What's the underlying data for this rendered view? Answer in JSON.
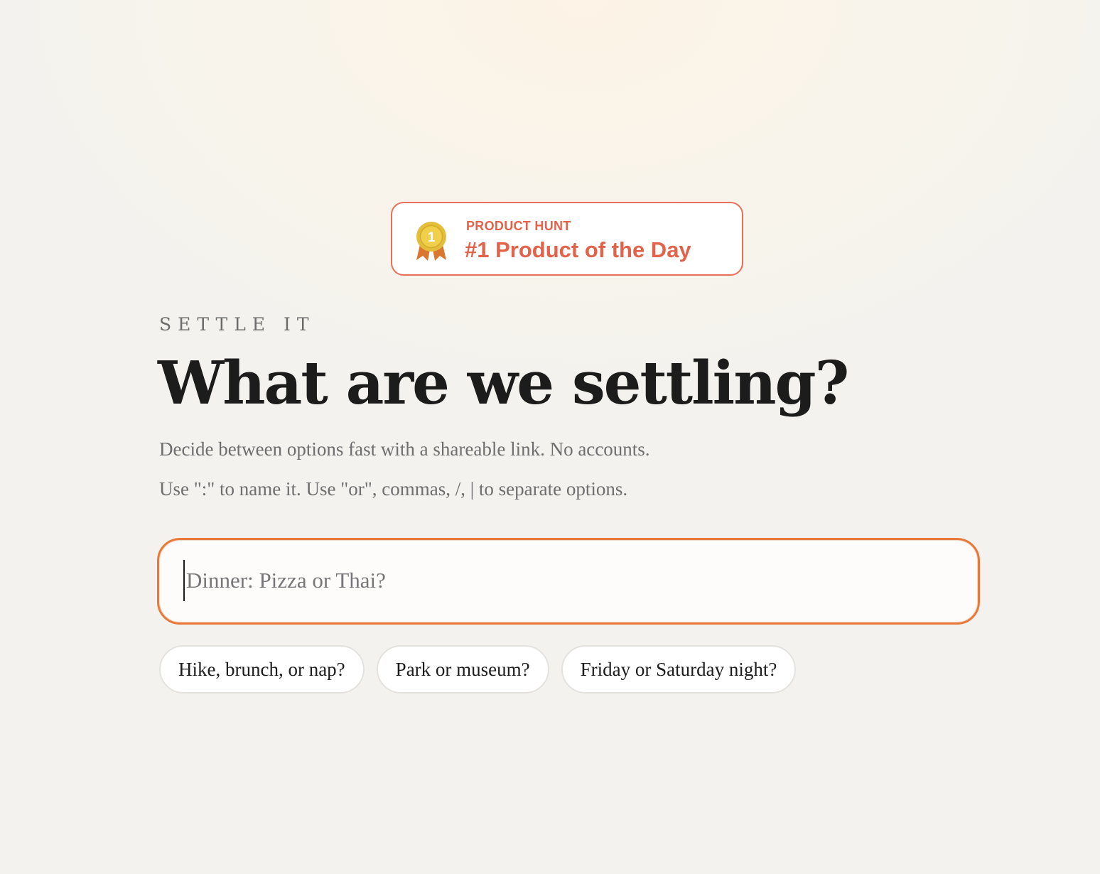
{
  "badge": {
    "medal_number": "1",
    "kicker": "PRODUCT HUNT",
    "headline": "#1 Product of the Day",
    "medal_icon": "medal-icon",
    "colors": {
      "accent": "#e2624a",
      "gold": "#e3be3a",
      "ribbon": "#d9762f"
    }
  },
  "hero": {
    "eyebrow": "SETTLE IT",
    "title": "What are we settling?",
    "subtitle": "Decide between options fast with a shareable link. No accounts.",
    "hint": "Use \":\" to name it. Use \"or\", commas, /, | to separate options."
  },
  "input": {
    "value": "",
    "placeholder": "Dinner: Pizza or Thai?",
    "focus_color": "#e8793a"
  },
  "suggestions": [
    "Hike, brunch, or nap?",
    "Park or museum?",
    "Friday or Saturday night?"
  ]
}
